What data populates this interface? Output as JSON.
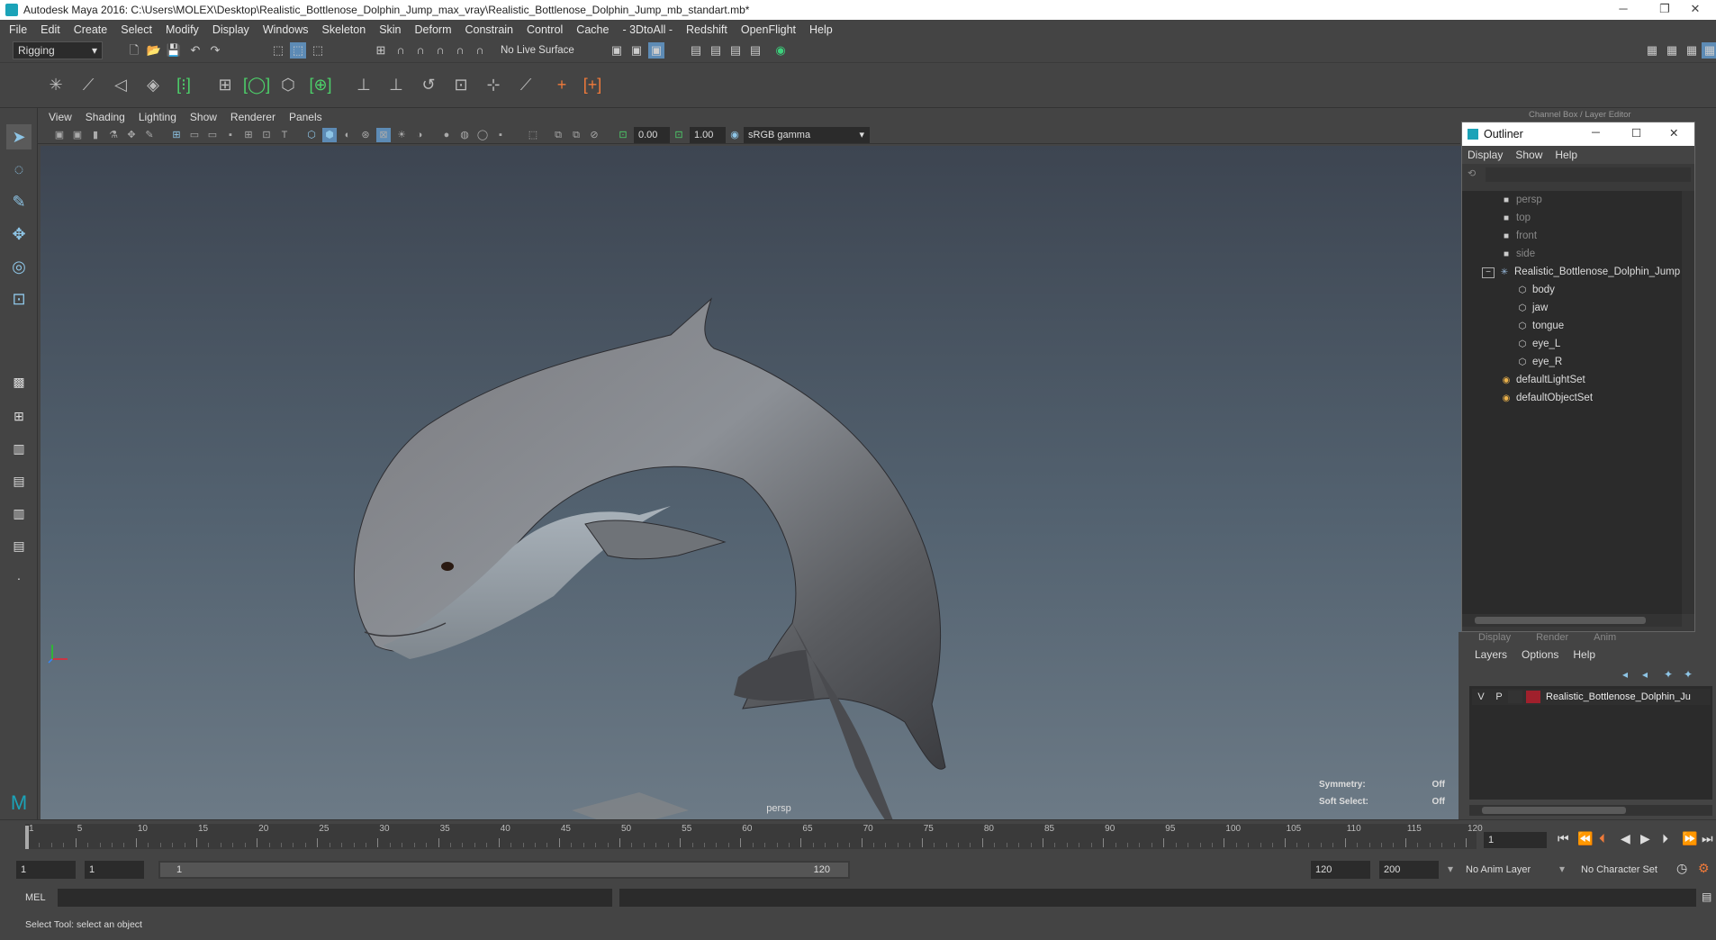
{
  "window": {
    "title": "Autodesk Maya 2016: C:\\Users\\MOLEX\\Desktop\\Realistic_Bottlenose_Dolphin_Jump_max_vray\\Realistic_Bottlenose_Dolphin_Jump_mb_standart.mb*"
  },
  "menubar": [
    "File",
    "Edit",
    "Create",
    "Select",
    "Modify",
    "Display",
    "Windows",
    "Skeleton",
    "Skin",
    "Deform",
    "Constrain",
    "Control",
    "Cache",
    "- 3DtoAll -",
    "Redshift",
    "OpenFlight",
    "Help"
  ],
  "status": {
    "mode": "Rigging",
    "live_surface": "No Live Surface"
  },
  "panel_menu": [
    "View",
    "Shading",
    "Lighting",
    "Show",
    "Renderer",
    "Panels"
  ],
  "panel_toolbar": {
    "exposure": "0.00",
    "gamma": "1.00",
    "color_space": "sRGB gamma"
  },
  "viewport": {
    "camera": "persp",
    "symmetry_label": "Symmetry:",
    "symmetry_value": "Off",
    "soft_select_label": "Soft Select:",
    "soft_select_value": "Off"
  },
  "outliner": {
    "title": "Outliner",
    "menu": [
      "Display",
      "Show",
      "Help"
    ],
    "items": [
      "persp",
      "top",
      "front",
      "side",
      "Realistic_Bottlenose_Dolphin_Jump",
      "body",
      "jaw",
      "tongue",
      "eye_L",
      "eye_R",
      "defaultLightSet",
      "defaultObjectSet"
    ]
  },
  "channel_box_header": "Channel Box / Layer Editor",
  "layer_editor": {
    "tabs": [
      "Display",
      "Render",
      "Anim"
    ],
    "menu": [
      "Layers",
      "Options",
      "Help"
    ],
    "layer": {
      "v": "V",
      "p": "P",
      "name": "Realistic_Bottlenose_Dolphin_Ju",
      "color": "#a0202c"
    }
  },
  "timeline": {
    "ticks": [
      "1",
      "5",
      "10",
      "15",
      "20",
      "25",
      "30",
      "35",
      "40",
      "45",
      "50",
      "55",
      "60",
      "65",
      "70",
      "75",
      "80",
      "85",
      "90",
      "95",
      "100",
      "105",
      "110",
      "115",
      "120"
    ],
    "current_frame": "1"
  },
  "range": {
    "start": "1",
    "playback_start": "1",
    "range_label_start": "1",
    "range_label_end": "120",
    "playback_end": "120",
    "end": "200",
    "anim_layer": "No Anim Layer",
    "char_set": "No Character Set"
  },
  "command": {
    "label": "MEL"
  },
  "help": {
    "text": "Select Tool: select an object"
  }
}
